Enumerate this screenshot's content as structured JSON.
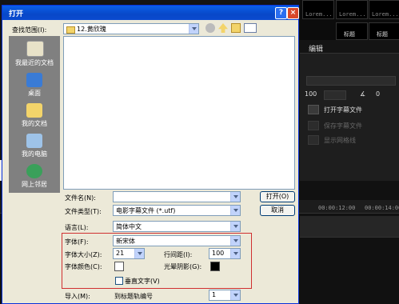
{
  "background_app": {
    "thumb_labels": [
      "Lorem...",
      "Lorem...",
      "Lorem..."
    ],
    "thumb_titles": [
      "标题",
      "标题"
    ],
    "panel_title": "编辑",
    "value_100": "100",
    "value_0": "0",
    "open_subtitle": "打开字幕文件",
    "save_subtitle": "保存字幕文件",
    "show_grid": "显示网格线",
    "ruler_ticks": [
      "00:00:12:00",
      "00:00:14:00"
    ]
  },
  "dialog": {
    "title": "打开",
    "help_btn": "?",
    "close_btn": "×",
    "lookin_label": "查找范围(I):",
    "lookin_value": "12.黄欣瑰",
    "places": [
      "我最近的文档",
      "桌面",
      "我的文档",
      "我的电脑",
      "网上邻居"
    ],
    "filename_label": "文件名(N):",
    "filename_value": "",
    "filetype_label": "文件类型(T):",
    "filetype_value": "电影字幕文件 (*.utf)",
    "open_btn": "打开(O)",
    "cancel_btn": "取消",
    "language_label": "语言(L):",
    "language_value": "简体中文",
    "font_label": "字体(F):",
    "font_value": "新宋体",
    "size_label": "字体大小(Z):",
    "size_value": "21",
    "spacing_label": "行间距(I):",
    "spacing_value": "100",
    "color_label": "字体颜色(C):",
    "shadow_label": "光晕阴影(G):",
    "vertical_label": "垂直文字(V)",
    "import_label": "导入(M):",
    "import_value": "到标题轨编号",
    "import_track": "1"
  },
  "colors": {
    "font_color": "#ffffff",
    "shadow_color": "#000000"
  }
}
